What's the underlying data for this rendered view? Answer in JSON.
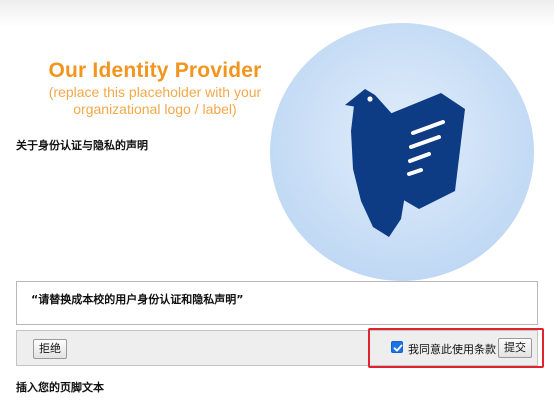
{
  "logo": {
    "title": "Our Identity Provider",
    "subtitle_line1": "(replace this placeholder with your",
    "subtitle_line2": "organizational logo / label)",
    "title_color": "#f2951f"
  },
  "privacy_heading": "关于身份认证与隐私的声明",
  "badge": {
    "icon": "bird-book-icon",
    "circle_color": "#cfe2f7",
    "icon_color": "#0d3b84"
  },
  "statement": "“请替换成本校的用户身份认证和隐私声明”",
  "actions": {
    "reject_label": "拒绝",
    "agree_label": "我同意此使用条款",
    "agree_checked": true,
    "submit_label": "提交",
    "highlight_color": "#e0232c"
  },
  "footer": "插入您的页脚文本"
}
